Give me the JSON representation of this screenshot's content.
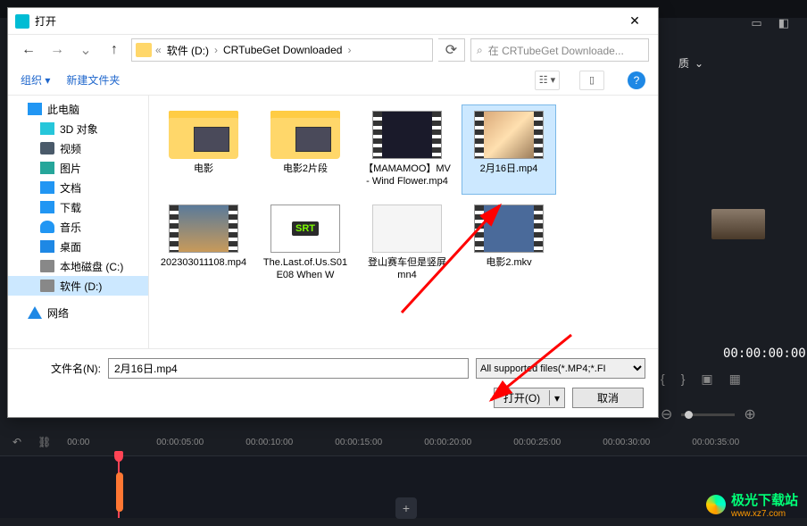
{
  "dialog": {
    "title": "打开",
    "nav": {
      "back": "←",
      "fwd": "→",
      "up": "↑",
      "refresh": "⟳"
    },
    "breadcrumb": {
      "sep1": "«",
      "drive": "软件 (D:)",
      "folder": "CRTubeGet Downloaded"
    },
    "search_placeholder": "在 CRTubeGet Downloade...",
    "toolbar": {
      "organize": "组织",
      "newfolder": "新建文件夹"
    },
    "sidebar": {
      "pc": "此电脑",
      "threeD": "3D 对象",
      "video": "视频",
      "pictures": "图片",
      "docs": "文档",
      "downloads": "下载",
      "music": "音乐",
      "desktop": "桌面",
      "cdrive": "本地磁盘 (C:)",
      "ddrive": "软件 (D:)",
      "network": "网络"
    },
    "files": [
      {
        "k": "movie1",
        "name": "电影",
        "type": "folder"
      },
      {
        "k": "movie2",
        "name": "电影2片段",
        "type": "folder"
      },
      {
        "k": "mama",
        "name": "【MAMAMOO】MV- Wind Flower.mp4",
        "type": "video-dark"
      },
      {
        "k": "feb16",
        "name": "2月16日.mp4",
        "type": "video-gal",
        "selected": true
      },
      {
        "k": "longnum",
        "name": "202303011108.mp4",
        "type": "video-img"
      },
      {
        "k": "lastofus",
        "name": "The.Last.of.Us.S01E08 When W",
        "type": "srt"
      },
      {
        "k": "climb",
        "name": "登山赛车但是竖屏   mn4",
        "type": "app"
      },
      {
        "k": "mov2mkv",
        "name": "电影2.mkv",
        "type": "video-blue"
      }
    ],
    "filename_label": "文件名(N):",
    "filename_value": "2月16日.mp4",
    "filter": "All supported files(*.MP4;*.FI",
    "open_btn": "打开(O)",
    "cancel_btn": "取消"
  },
  "editor": {
    "quality_label": "质",
    "timecode": "00:00:00:00",
    "timeline_icons": {
      "undo": "↶",
      "link": "⛓"
    },
    "ticks": [
      "00:00",
      "00:00:05:00",
      "00:00:10:00",
      "00:00:15:00",
      "00:00:20:00",
      "00:00:25:00",
      "00:00:30:00",
      "00:00:35:00"
    ]
  },
  "watermark": {
    "brand": "极光下载站",
    "url": "www.xz7.com"
  }
}
